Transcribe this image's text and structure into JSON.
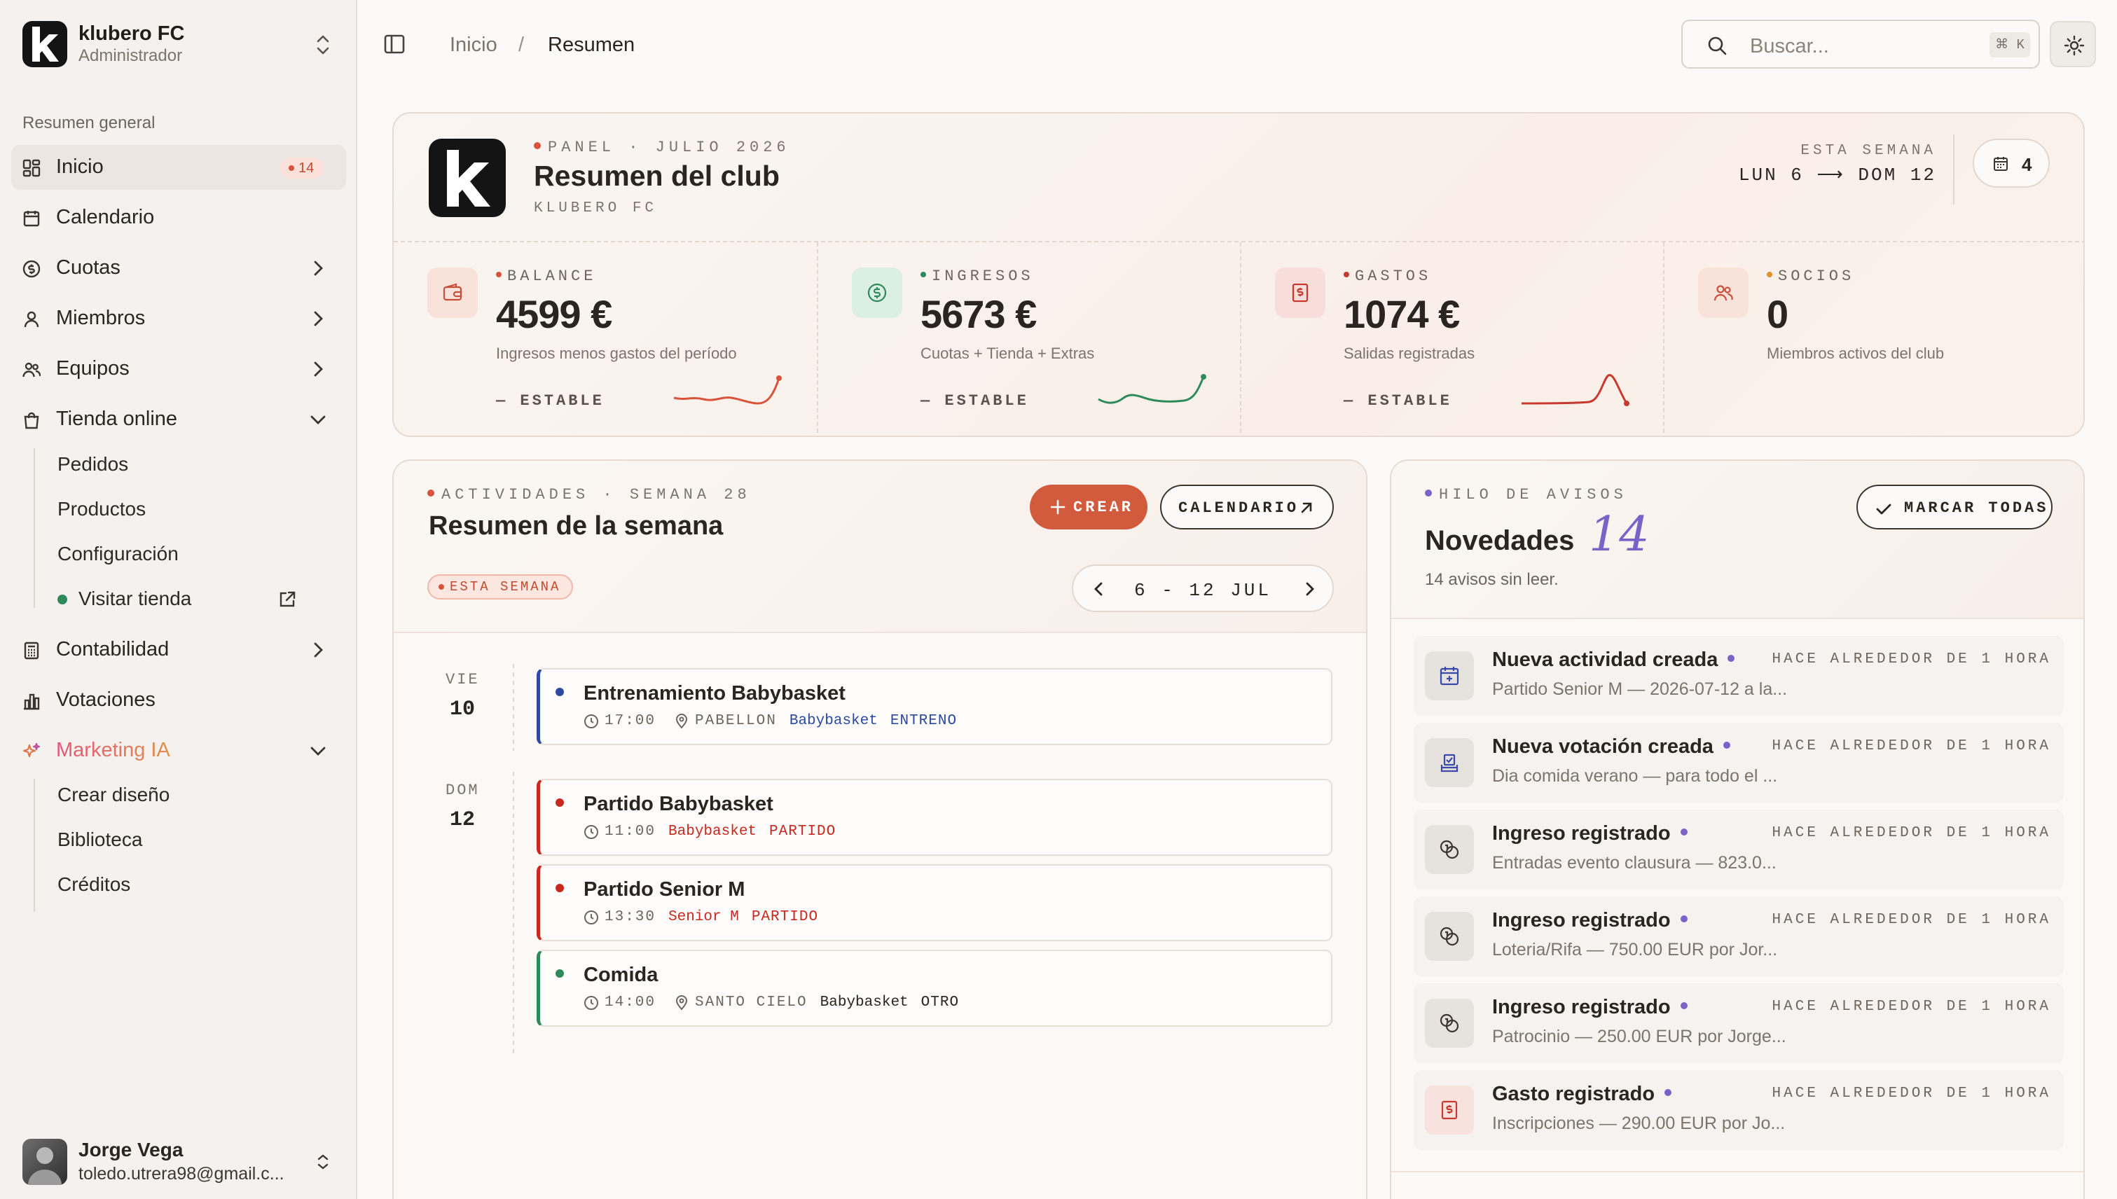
{
  "sidebar": {
    "club_name": "klubero FC",
    "club_role": "Administrador",
    "section_label": "Resumen general",
    "items": [
      {
        "label": "Inicio",
        "icon": "grid-icon",
        "badge": "14"
      },
      {
        "label": "Calendario",
        "icon": "calendar-icon"
      },
      {
        "label": "Cuotas",
        "icon": "coin-icon"
      },
      {
        "label": "Miembros",
        "icon": "user-icon"
      },
      {
        "label": "Equipos",
        "icon": "users-icon"
      },
      {
        "label": "Tienda online",
        "icon": "bag-icon"
      },
      {
        "label": "Contabilidad",
        "icon": "calculator-icon"
      },
      {
        "label": "Votaciones",
        "icon": "bar-chart-icon"
      },
      {
        "label": "Marketing IA",
        "icon": "sparkles-icon"
      }
    ],
    "shop_sub": [
      "Pedidos",
      "Productos",
      "Configuración",
      "Visitar tienda"
    ],
    "marketing_sub": [
      "Crear diseño",
      "Biblioteca",
      "Créditos"
    ],
    "user": {
      "name": "Jorge Vega",
      "email": "toledo.utrera98@gmail.c..."
    }
  },
  "topbar": {
    "breadcrumb": [
      "Inicio",
      "/",
      "Resumen"
    ],
    "search_placeholder": "Buscar...",
    "shortcut": "⌘ K"
  },
  "summary": {
    "eyebrow": "PANEL · JULIO 2026",
    "title": "Resumen del club",
    "subtitle": "KLUBERO FC",
    "week_label": "ESTA SEMANA",
    "week_range": "LUN 6 ⟶ DOM 12",
    "calendar_count": "4",
    "stats": [
      {
        "label": "BALANCE",
        "value": "4599 €",
        "desc": "Ingresos menos gastos del período",
        "trend": "— ESTABLE",
        "color": "#d9533a"
      },
      {
        "label": "INGRESOS",
        "value": "5673 €",
        "desc": "Cuotas + Tienda + Extras",
        "trend": "— ESTABLE",
        "color": "#2f8a5b"
      },
      {
        "label": "GASTOS",
        "value": "1074 €",
        "desc": "Salidas registradas",
        "trend": "— ESTABLE",
        "color": "#c83a2e"
      },
      {
        "label": "SOCIOS",
        "value": "0",
        "desc": "Miembros activos del club",
        "trend": "",
        "color": "#e0902e"
      }
    ]
  },
  "activities": {
    "eyebrow": "ACTIVIDADES · SEMANA 28",
    "title": "Resumen de la semana",
    "create_label": "CREAR",
    "calendar_label": "CALENDARIO",
    "week_badge": "ESTA SEMANA",
    "range": "6 - 12 JUL",
    "days": [
      {
        "dow": "VIE",
        "num": "10",
        "events": [
          {
            "title": "Entrenamiento Babybasket",
            "time": "17:00",
            "place": "PABELLON",
            "team": "Babybasket",
            "type": "ENTRENO",
            "color": "#2b4aa0"
          }
        ]
      },
      {
        "dow": "DOM",
        "num": "12",
        "events": [
          {
            "title": "Partido Babybasket",
            "time": "11:00",
            "place": "",
            "team": "Babybasket",
            "type": "PARTIDO",
            "color": "#c8281e"
          },
          {
            "title": "Partido Senior M",
            "time": "13:30",
            "place": "",
            "team": "Senior M",
            "type": "PARTIDO",
            "color": "#c8281e"
          },
          {
            "title": "Comida",
            "time": "14:00",
            "place": "SANTO CIELO",
            "team": "Babybasket",
            "type": "OTRO",
            "color": "#2f8a5b"
          }
        ]
      }
    ]
  },
  "notices": {
    "eyebrow": "HILO DE AVISOS",
    "title": "Novedades",
    "count": "14",
    "subtitle": "14 avisos sin leer.",
    "mark_all_label": "MARCAR TODAS",
    "items": [
      {
        "title": "Nueva actividad creada",
        "time": "HACE ALREDEDOR DE 1 HORA",
        "desc": "Partido Senior M — 2026-07-12 a la...",
        "icon": "calendar-plus-icon"
      },
      {
        "title": "Nueva votación creada",
        "time": "HACE ALREDEDOR DE 1 HORA",
        "desc": "Dia comida verano — para todo el ...",
        "icon": "vote-icon"
      },
      {
        "title": "Ingreso registrado",
        "time": "HACE ALREDEDOR DE 1 HORA",
        "desc": "Entradas evento clausura — 823.0...",
        "icon": "coins-icon"
      },
      {
        "title": "Ingreso registrado",
        "time": "HACE ALREDEDOR DE 1 HORA",
        "desc": "Loteria/Rifa — 750.00 EUR por Jor...",
        "icon": "coins-icon"
      },
      {
        "title": "Ingreso registrado",
        "time": "HACE ALREDEDOR DE 1 HORA",
        "desc": "Patrocinio — 250.00 EUR por Jorge...",
        "icon": "coins-icon"
      },
      {
        "title": "Gasto registrado",
        "time": "HACE ALREDEDOR DE 1 HORA",
        "desc": "Inscripciones — 290.00 EUR por Jo...",
        "icon": "receipt-icon"
      }
    ]
  }
}
